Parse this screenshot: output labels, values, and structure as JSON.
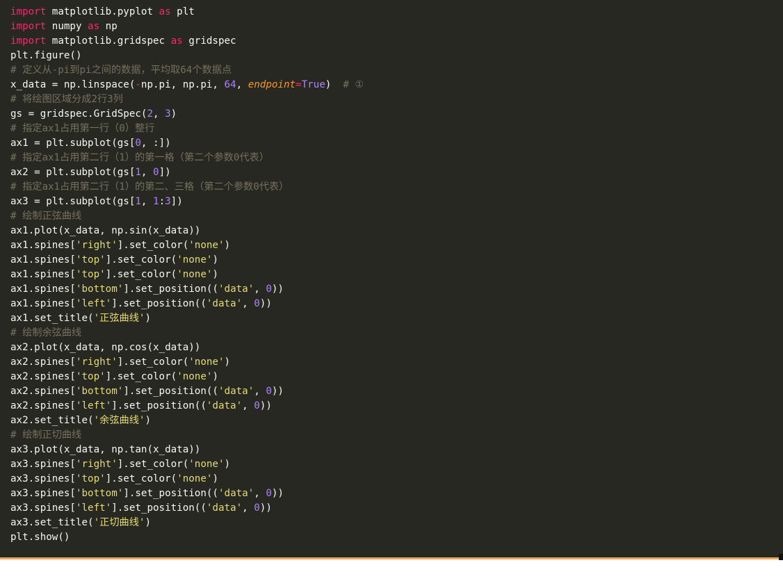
{
  "colors": {
    "background": "#272822",
    "text": "#f8f8f2",
    "keyword": "#f92672",
    "string": "#e6db74",
    "number": "#ae81ff",
    "comment": "#75715e",
    "kwarg": "#fd971f",
    "accent_bar": "#f0a85a"
  },
  "code_lines": [
    [
      {
        "t": "import",
        "c": "kw"
      },
      {
        "t": " matplotlib.pyplot "
      },
      {
        "t": "as",
        "c": "kw"
      },
      {
        "t": " plt"
      }
    ],
    [
      {
        "t": "import",
        "c": "kw"
      },
      {
        "t": " numpy "
      },
      {
        "t": "as",
        "c": "kw"
      },
      {
        "t": " np"
      }
    ],
    [
      {
        "t": "import",
        "c": "kw"
      },
      {
        "t": " matplotlib.gridspec "
      },
      {
        "t": "as",
        "c": "kw"
      },
      {
        "t": " gridspec"
      }
    ],
    [
      {
        "t": "plt.figure()"
      }
    ],
    [
      {
        "t": "# 定义从-pi到pi之间的数据，平均取64个数据点",
        "c": "com"
      }
    ],
    [
      {
        "t": "x_data = np.linspace("
      },
      {
        "t": "-",
        "c": "kw"
      },
      {
        "t": "np.pi, np.pi, "
      },
      {
        "t": "64",
        "c": "num"
      },
      {
        "t": ", "
      },
      {
        "t": "endpoint",
        "c": "kwarg"
      },
      {
        "t": "=",
        "c": "kw"
      },
      {
        "t": "True",
        "c": "num"
      },
      {
        "t": ")  "
      },
      {
        "t": "# ①",
        "c": "com"
      }
    ],
    [
      {
        "t": "# 将绘图区域分成2行3列",
        "c": "com"
      }
    ],
    [
      {
        "t": "gs = gridspec.GridSpec("
      },
      {
        "t": "2",
        "c": "num"
      },
      {
        "t": ", "
      },
      {
        "t": "3",
        "c": "num"
      },
      {
        "t": ")"
      }
    ],
    [
      {
        "t": "# 指定ax1占用第一行（0）整行",
        "c": "com"
      }
    ],
    [
      {
        "t": "ax1 = plt.subplot(gs["
      },
      {
        "t": "0",
        "c": "num"
      },
      {
        "t": ", :])"
      }
    ],
    [
      {
        "t": "# 指定ax1占用第二行（1）的第一格（第二个参数0代表）",
        "c": "com"
      }
    ],
    [
      {
        "t": "ax2 = plt.subplot(gs["
      },
      {
        "t": "1",
        "c": "num"
      },
      {
        "t": ", "
      },
      {
        "t": "0",
        "c": "num"
      },
      {
        "t": "])"
      }
    ],
    [
      {
        "t": "# 指定ax1占用第二行（1）的第二、三格（第二个参数0代表）",
        "c": "com"
      }
    ],
    [
      {
        "t": "ax3 = plt.subplot(gs["
      },
      {
        "t": "1",
        "c": "num"
      },
      {
        "t": ", "
      },
      {
        "t": "1",
        "c": "num"
      },
      {
        "t": ":"
      },
      {
        "t": "3",
        "c": "num"
      },
      {
        "t": "])"
      }
    ],
    [
      {
        "t": "# 绘制正弦曲线",
        "c": "com"
      }
    ],
    [
      {
        "t": "ax1.plot(x_data, np.sin(x_data))"
      }
    ],
    [
      {
        "t": "ax1.spines["
      },
      {
        "t": "'right'",
        "c": "str"
      },
      {
        "t": "].set_color("
      },
      {
        "t": "'none'",
        "c": "str"
      },
      {
        "t": ")"
      }
    ],
    [
      {
        "t": "ax1.spines["
      },
      {
        "t": "'top'",
        "c": "str"
      },
      {
        "t": "].set_color("
      },
      {
        "t": "'none'",
        "c": "str"
      },
      {
        "t": ")"
      }
    ],
    [
      {
        "t": "ax1.spines["
      },
      {
        "t": "'top'",
        "c": "str"
      },
      {
        "t": "].set_color("
      },
      {
        "t": "'none'",
        "c": "str"
      },
      {
        "t": ")"
      }
    ],
    [
      {
        "t": "ax1.spines["
      },
      {
        "t": "'bottom'",
        "c": "str"
      },
      {
        "t": "].set_position(("
      },
      {
        "t": "'data'",
        "c": "str"
      },
      {
        "t": ", "
      },
      {
        "t": "0",
        "c": "num"
      },
      {
        "t": "))"
      }
    ],
    [
      {
        "t": "ax1.spines["
      },
      {
        "t": "'left'",
        "c": "str"
      },
      {
        "t": "].set_position(("
      },
      {
        "t": "'data'",
        "c": "str"
      },
      {
        "t": ", "
      },
      {
        "t": "0",
        "c": "num"
      },
      {
        "t": "))"
      }
    ],
    [
      {
        "t": "ax1.set_title("
      },
      {
        "t": "'正弦曲线'",
        "c": "str"
      },
      {
        "t": ")"
      }
    ],
    [
      {
        "t": "# 绘制余弦曲线",
        "c": "com"
      }
    ],
    [
      {
        "t": "ax2.plot(x_data, np.cos(x_data))"
      }
    ],
    [
      {
        "t": "ax2.spines["
      },
      {
        "t": "'right'",
        "c": "str"
      },
      {
        "t": "].set_color("
      },
      {
        "t": "'none'",
        "c": "str"
      },
      {
        "t": ")"
      }
    ],
    [
      {
        "t": "ax2.spines["
      },
      {
        "t": "'top'",
        "c": "str"
      },
      {
        "t": "].set_color("
      },
      {
        "t": "'none'",
        "c": "str"
      },
      {
        "t": ")"
      }
    ],
    [
      {
        "t": "ax2.spines["
      },
      {
        "t": "'bottom'",
        "c": "str"
      },
      {
        "t": "].set_position(("
      },
      {
        "t": "'data'",
        "c": "str"
      },
      {
        "t": ", "
      },
      {
        "t": "0",
        "c": "num"
      },
      {
        "t": "))"
      }
    ],
    [
      {
        "t": "ax2.spines["
      },
      {
        "t": "'left'",
        "c": "str"
      },
      {
        "t": "].set_position(("
      },
      {
        "t": "'data'",
        "c": "str"
      },
      {
        "t": ", "
      },
      {
        "t": "0",
        "c": "num"
      },
      {
        "t": "))"
      }
    ],
    [
      {
        "t": "ax2.set_title("
      },
      {
        "t": "'余弦曲线'",
        "c": "str"
      },
      {
        "t": ")"
      }
    ],
    [
      {
        "t": "# 绘制正切曲线",
        "c": "com"
      }
    ],
    [
      {
        "t": "ax3.plot(x_data, np.tan(x_data))"
      }
    ],
    [
      {
        "t": "ax3.spines["
      },
      {
        "t": "'right'",
        "c": "str"
      },
      {
        "t": "].set_color("
      },
      {
        "t": "'none'",
        "c": "str"
      },
      {
        "t": ")"
      }
    ],
    [
      {
        "t": "ax3.spines["
      },
      {
        "t": "'top'",
        "c": "str"
      },
      {
        "t": "].set_color("
      },
      {
        "t": "'none'",
        "c": "str"
      },
      {
        "t": ")"
      }
    ],
    [
      {
        "t": "ax3.spines["
      },
      {
        "t": "'bottom'",
        "c": "str"
      },
      {
        "t": "].set_position(("
      },
      {
        "t": "'data'",
        "c": "str"
      },
      {
        "t": ", "
      },
      {
        "t": "0",
        "c": "num"
      },
      {
        "t": "))"
      }
    ],
    [
      {
        "t": "ax3.spines["
      },
      {
        "t": "'left'",
        "c": "str"
      },
      {
        "t": "].set_position(("
      },
      {
        "t": "'data'",
        "c": "str"
      },
      {
        "t": ", "
      },
      {
        "t": "0",
        "c": "num"
      },
      {
        "t": "))"
      }
    ],
    [
      {
        "t": "ax3.set_title("
      },
      {
        "t": "'正切曲线'",
        "c": "str"
      },
      {
        "t": ")"
      }
    ],
    [
      {
        "t": "plt.show()"
      }
    ]
  ]
}
